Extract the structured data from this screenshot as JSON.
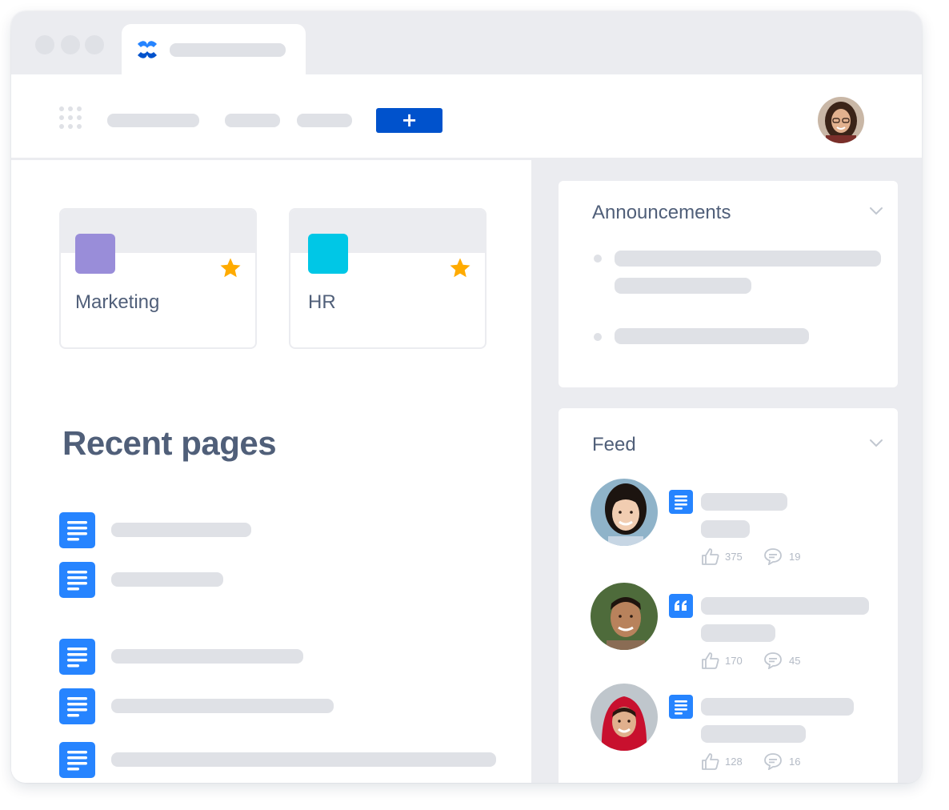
{
  "colors": {
    "primary": "#0052cc",
    "page_icon": "#2684ff",
    "marketing": "#998dd9",
    "hr": "#00c7e6",
    "star": "#ffab00",
    "placeholder": "#dfe1e6",
    "text": "#505f79"
  },
  "browser": {
    "tab_logo": "confluence-logo",
    "window_controls": [
      "close",
      "minimize",
      "maximize"
    ]
  },
  "topnav": {
    "apps_icon": "app-switcher-icon",
    "create_label": "+",
    "profile_avatar": "user-avatar"
  },
  "spaces": [
    {
      "name": "Marketing",
      "icon_color": "#998dd9",
      "starred": true
    },
    {
      "name": "HR",
      "icon_color": "#00c7e6",
      "starred": true
    }
  ],
  "recent": {
    "title": "Recent pages",
    "page_icon": "page-icon"
  },
  "announcements": {
    "title": "Announcements"
  },
  "feed": {
    "title": "Feed",
    "items": [
      {
        "type": "page",
        "likes": "375",
        "comments": "19"
      },
      {
        "type": "quote",
        "likes": "170",
        "comments": "45"
      },
      {
        "type": "page",
        "likes": "128",
        "comments": "16"
      }
    ]
  }
}
